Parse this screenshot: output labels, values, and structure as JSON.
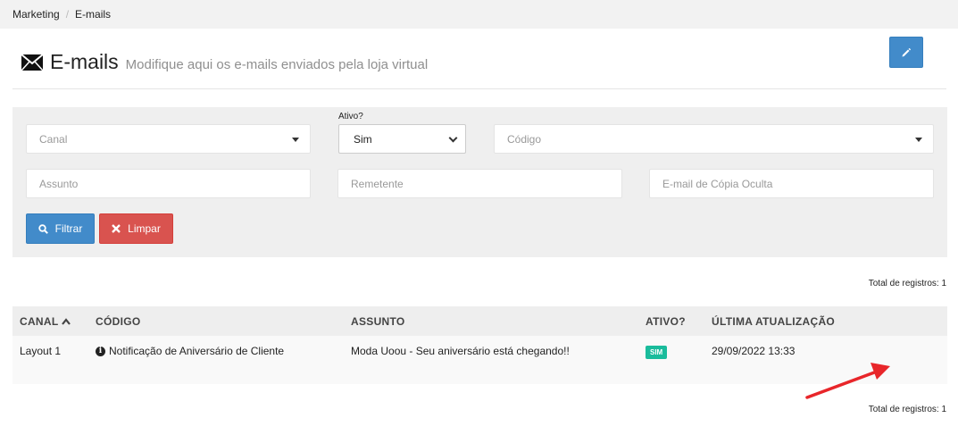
{
  "breadcrumb": {
    "items": [
      "Marketing",
      "E-mails"
    ]
  },
  "header": {
    "icon": "envelope-icon",
    "title": "E-mails",
    "subtitle": "Modifique aqui os e-mails enviados pela loja virtual"
  },
  "filters": {
    "canal": {
      "placeholder": "Canal"
    },
    "ativo": {
      "label": "Ativo?",
      "value": "Sim"
    },
    "codigo": {
      "placeholder": "Código"
    },
    "assunto": {
      "placeholder": "Assunto"
    },
    "remetente": {
      "placeholder": "Remetente"
    },
    "bcc": {
      "placeholder": "E-mail de Cópia Oculta"
    },
    "filter_button": "Filtrar",
    "clear_button": "Limpar"
  },
  "total_top": "Total de registros: 1",
  "total_bottom": "Total de registros: 1",
  "table": {
    "headers": [
      "CANAL",
      "CÓDIGO",
      "ASSUNTO",
      "ATIVO?",
      "ÚLTIMA ATUALIZAÇÃO"
    ],
    "rows": [
      {
        "canal": "Layout 1",
        "codigo": "Notificação de Aniversário de Cliente",
        "assunto": "Moda Uoou - Seu aniversário está chegando!!",
        "ativo": "SIM",
        "atualizacao": "29/09/2022 13:33"
      }
    ]
  },
  "colors": {
    "primary": "#428bca",
    "danger": "#d9534f",
    "badge": "#1abc9c",
    "arrow": "#e8262a"
  }
}
